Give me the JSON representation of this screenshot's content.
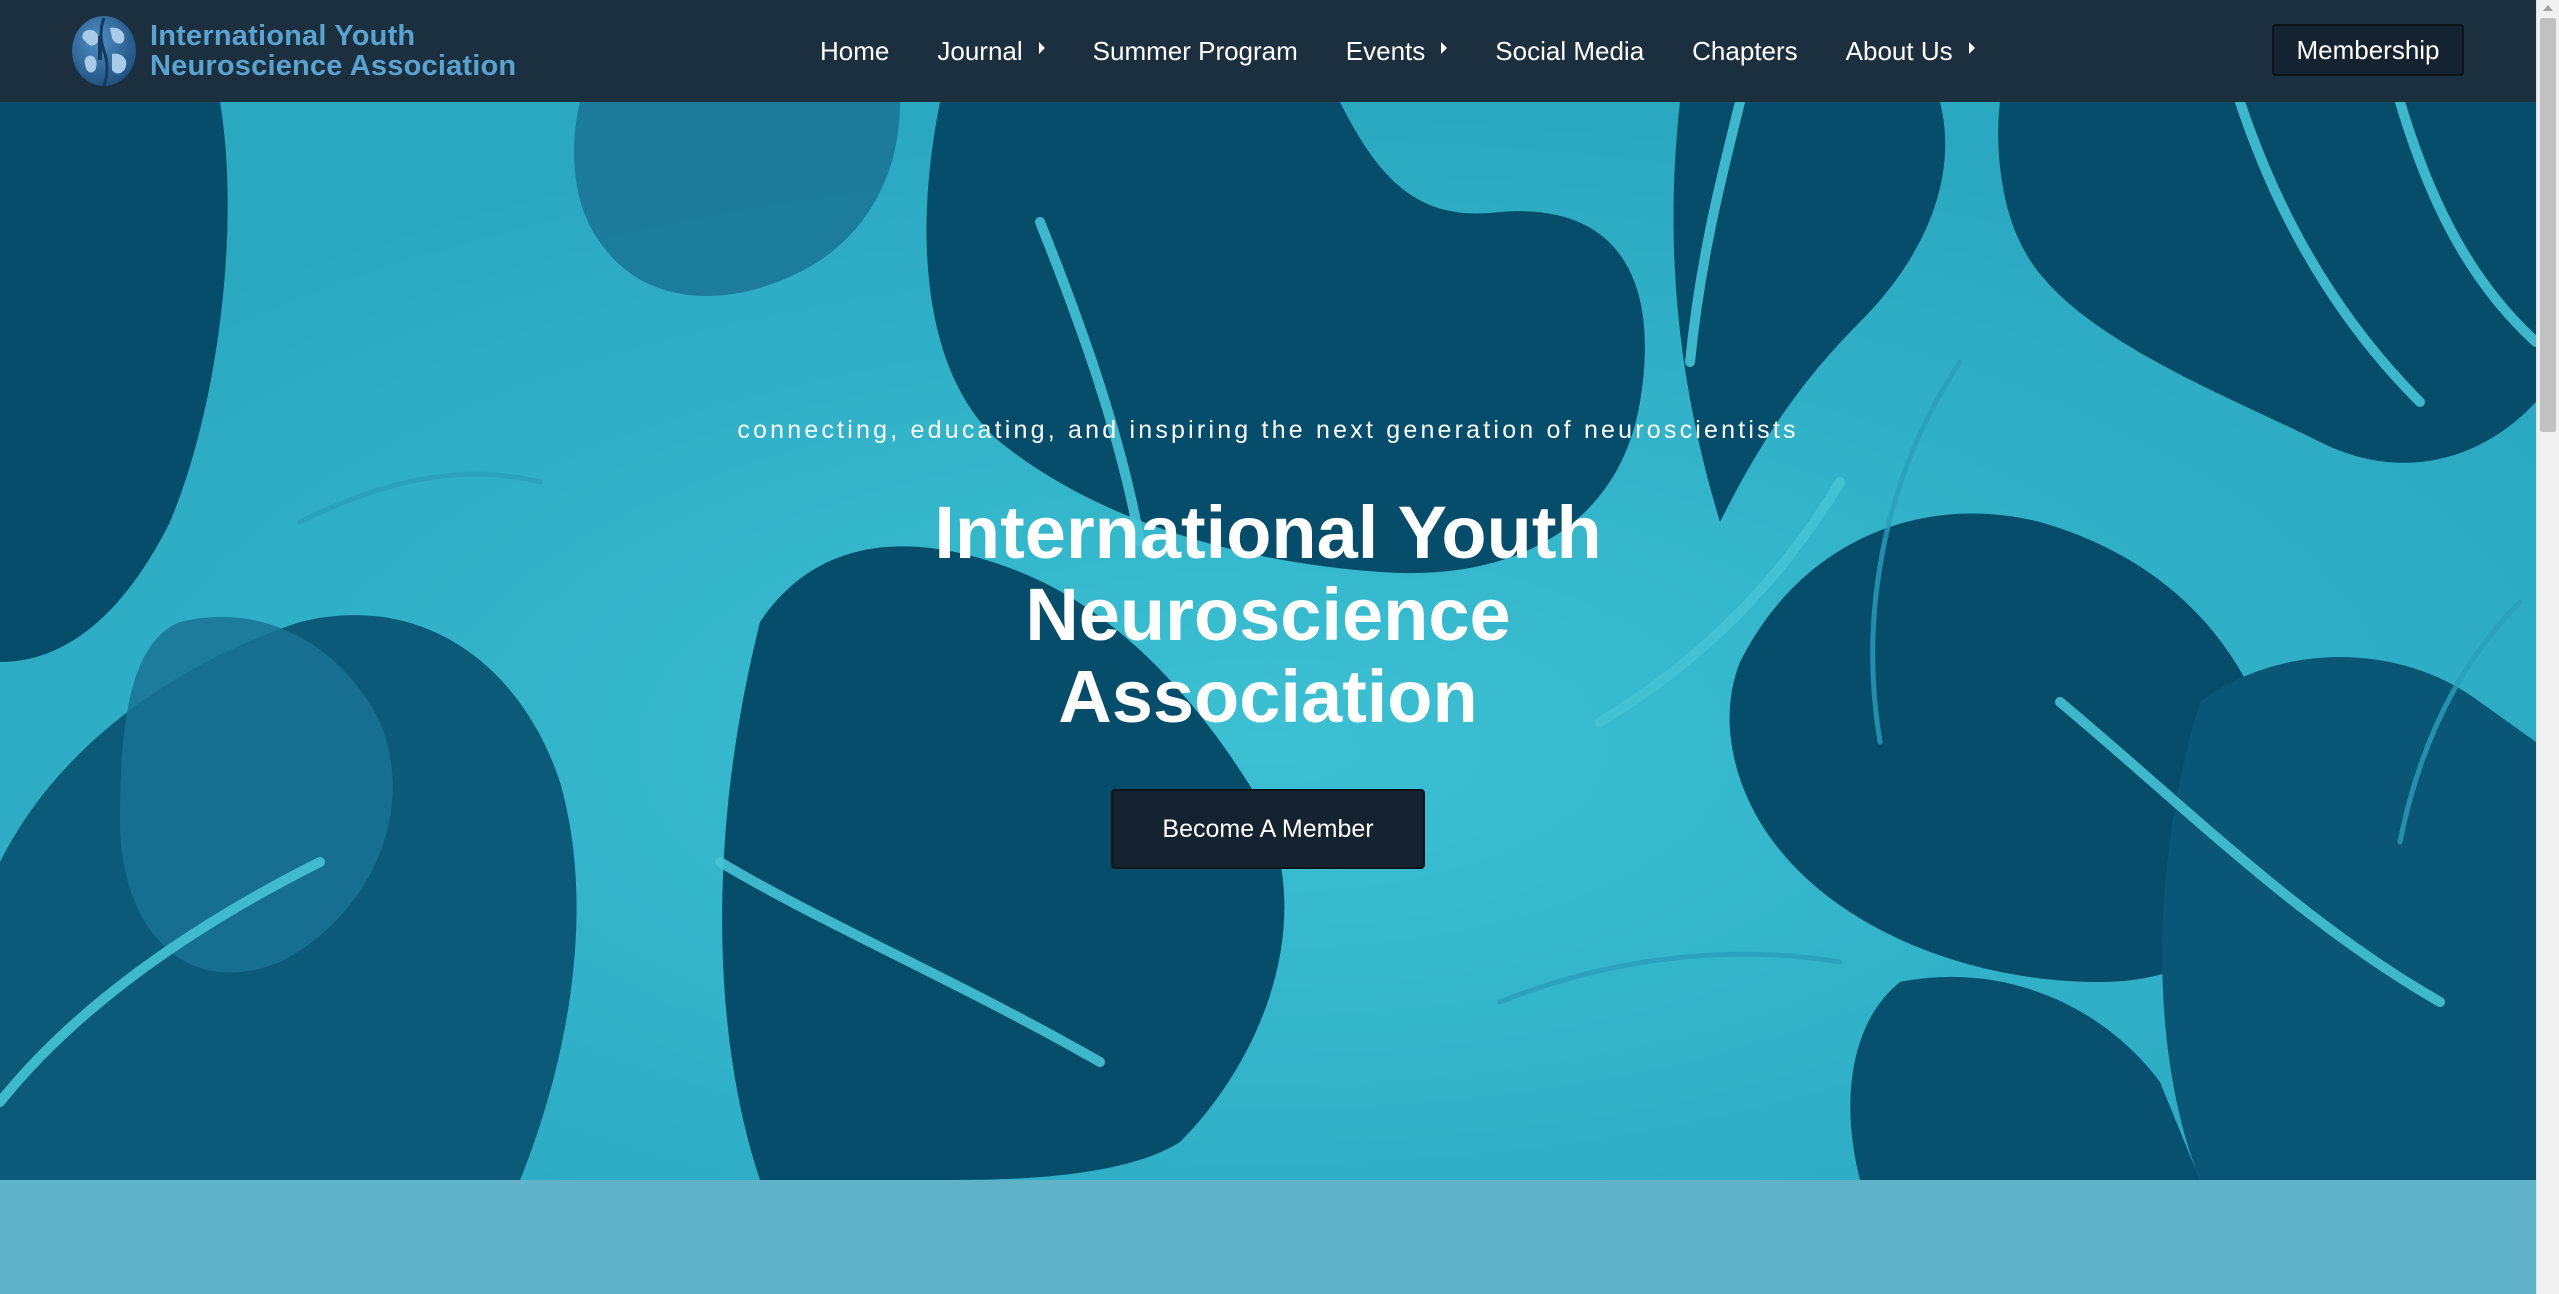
{
  "brand": {
    "logo_icon": "globe-brain-icon",
    "line1": "International Youth",
    "line2": "Neuroscience Association"
  },
  "nav": {
    "items": [
      {
        "label": "Home",
        "dropdown": false
      },
      {
        "label": "Journal",
        "dropdown": true
      },
      {
        "label": "Summer Program",
        "dropdown": false
      },
      {
        "label": "Events",
        "dropdown": true
      },
      {
        "label": "Social Media",
        "dropdown": false
      },
      {
        "label": "Chapters",
        "dropdown": false
      },
      {
        "label": "About Us",
        "dropdown": true
      }
    ],
    "membership_label": "Membership"
  },
  "hero": {
    "tagline": "connecting, educating, and inspiring the next generation of neuroscientists",
    "title_line1": "International Youth",
    "title_line2": "Neuroscience",
    "title_line3": "Association",
    "cta_label": "Become A Member"
  },
  "colors": {
    "navbar_bg": "#1b2f3e",
    "brand_text": "#5aa2cf",
    "hero_light": "#2fb3c7",
    "hero_dark": "#054a68",
    "button_bg": "#14232f",
    "section_below": "#60b3c9"
  }
}
